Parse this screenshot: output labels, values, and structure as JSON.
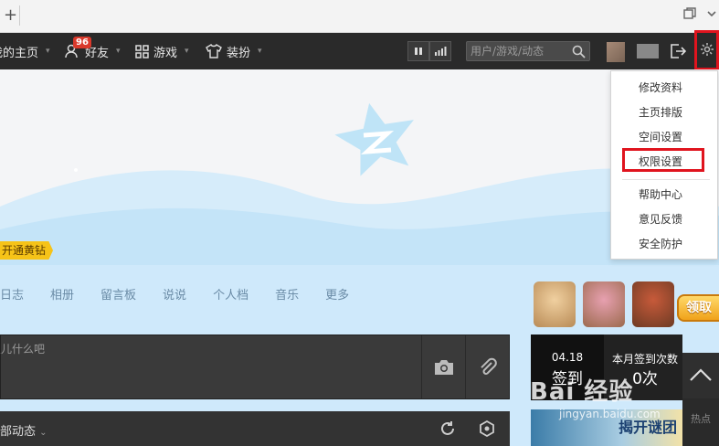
{
  "browser": {
    "new_tab": "+",
    "icons": [
      "restore-icon",
      "chevron-down-icon"
    ]
  },
  "nav": {
    "home": "我的主页",
    "friends": "好友",
    "friends_badge": "96",
    "games": "游戏",
    "dressup": "装扮",
    "search_placeholder": "用户/游戏/动态"
  },
  "cover": {
    "vip_button": "开通黄钻",
    "colors": {
      "star": "#bfe4f7",
      "wave": "#cde9f8"
    }
  },
  "tabs": [
    "日志",
    "相册",
    "留言板",
    "说说",
    "个人档",
    "音乐",
    "更多"
  ],
  "claim_button": "领取",
  "post": {
    "placeholder": "说点儿什么吧"
  },
  "feed": {
    "label": "全部动态"
  },
  "signin": {
    "date": "04.18",
    "sign_label": "签到",
    "month_label": "本月签到次数",
    "count": "0次"
  },
  "side": {
    "hot_label": "热点",
    "banner_text": "揭开谜团"
  },
  "menu": {
    "items": [
      "修改资料",
      "主页排版",
      "空间设置",
      "权限设置",
      "帮助中心",
      "意见反馈",
      "安全防护"
    ]
  },
  "watermark": {
    "main": "Bai 经验",
    "url": "jingyan.baidu.com"
  }
}
